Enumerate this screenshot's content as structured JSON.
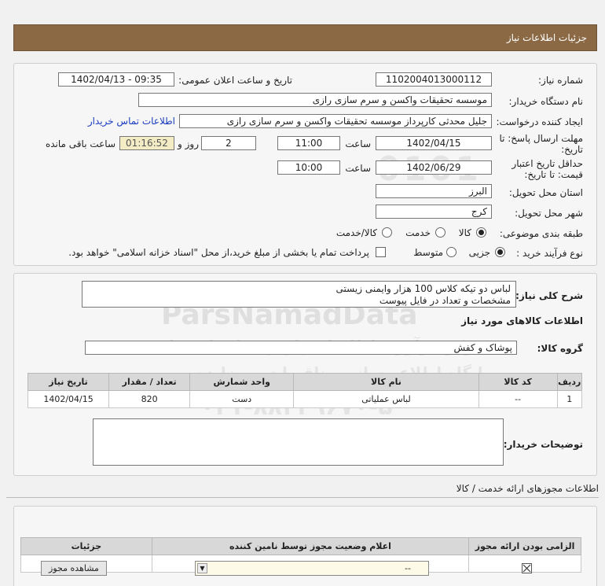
{
  "header": {
    "title": "جزئیات اطلاعات نیاز"
  },
  "fields": {
    "need_number_label": "شماره نیاز:",
    "need_number": "1102004013000112",
    "announce_label": "تاریخ و ساعت اعلان عمومی:",
    "announce_value": "1402/04/13 - 09:35",
    "buyer_org_label": "نام دستگاه خریدار:",
    "buyer_org": "موسسه تحقیقات واکسن و سرم سازی رازی",
    "requester_label": "ایجاد کننده درخواست:",
    "requester": "جلیل محدثی کارپرداز موسسه تحقیقات واکسن و سرم سازی رازی",
    "contact_link": "اطلاعات تماس خریدار",
    "deadline_label_1": "مهلت ارسال پاسخ: تا",
    "deadline_label_2": "تاریخ:",
    "deadline_date": "1402/04/15",
    "time_label": "ساعت",
    "deadline_time": "11:00",
    "days_value": "2",
    "days_label": "روز و",
    "remaining_time": "01:16:52",
    "remaining_label": "ساعت باقی مانده",
    "validity_label_1": "حداقل تاریخ اعتبار",
    "validity_label_2": "قیمت: تا تاریخ:",
    "validity_date": "1402/06/29",
    "validity_time": "10:00",
    "province_label": "استان محل تحویل:",
    "province": "البرز",
    "city_label": "شهر محل تحویل:",
    "city": "کرج",
    "category_label": "طبقه بندی موضوعی:",
    "category_options": [
      "کالا",
      "خدمت",
      "کالا/خدمت"
    ],
    "process_label": "نوع فرآیند خرید :",
    "process_options": [
      "جزیی",
      "متوسط"
    ],
    "payment_note": "پرداخت تمام یا بخشی از مبلغ خرید،از محل \"اسناد خزانه اسلامی\" خواهد بود."
  },
  "description": {
    "label": "شرح کلی نیاز:",
    "line1": "لباس دو تیکه کلاس 100 هزار وایمنی زیستی",
    "line2": "مشخصات و تعداد در فایل پیوست"
  },
  "goods": {
    "section_title": "اطلاعات کالاهای مورد نیاز",
    "group_label": "گروه کالا:",
    "group_value": "پوشاک و کفش",
    "columns": [
      "ردیف",
      "کد کالا",
      "نام کالا",
      "واحد شمارش",
      "تعداد / مقدار",
      "تاریخ نیاز"
    ],
    "rows": [
      [
        "1",
        "--",
        "لباس عملیاتی",
        "دست",
        "820",
        "1402/04/15"
      ]
    ]
  },
  "buyer_notes": {
    "label": "توضیحات خریدار:",
    "value": ""
  },
  "permits": {
    "section_title": "اطلاعات مجوزهای ارائه خدمت / کالا",
    "columns": [
      "الزامی بودن ارائه مجوز",
      "اعلام وضعیت مجوز توسط نامین کننده",
      "جزئیات"
    ],
    "select_value": "--",
    "view_button": "مشاهده مجوز"
  },
  "watermark": {
    "brand": "ParsNamadData",
    "line1": "مرکز فرآوری اطلاعات پارس نماد داده ها",
    "line2": "پایگاه اطلاع رسانی مناقصات و مزایده",
    "phone": "۰۲۱-۸۸۳۴۹۶۷۰-۵",
    "digits": "0101"
  },
  "colors": {
    "header_bg": "#8b6944",
    "link": "#1a3bc0",
    "remaining_bg": "#f3ecc4"
  }
}
